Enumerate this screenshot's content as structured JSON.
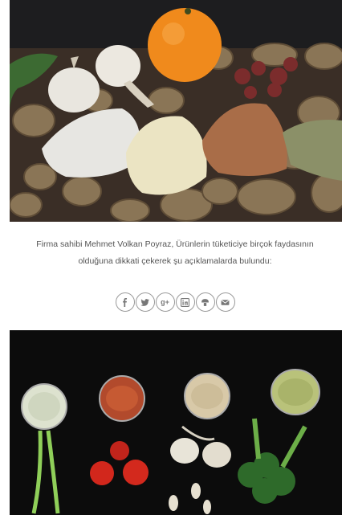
{
  "caption": {
    "text": "Firma sahibi Mehmet Volkan Poyraz, Ürünlerin tüketiciye birçok faydasının olduğuna dikkati çekerek şu açıklamalarda bulundu:"
  },
  "share": {
    "google_plus_label": "g+"
  },
  "colors": {
    "icon": "#777777",
    "border": "#9a9a9a",
    "text": "#555555"
  },
  "icons": [
    "facebook-icon",
    "twitter-icon",
    "google-plus-icon",
    "linkedin-icon",
    "stumbleupon-icon",
    "email-icon"
  ]
}
